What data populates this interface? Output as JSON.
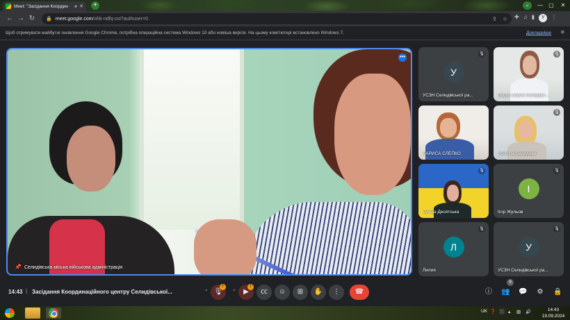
{
  "browser": {
    "tab_title": "Meet: \"Засідання Координ",
    "url_host": "meet.google.com",
    "url_path": "/ohk-ndfq-coi?authuser=0",
    "profile_initial": "У"
  },
  "infobar": {
    "message": "Щоб отримувати майбутні оновлення Google Chrome, потрібна операційна система Windows 10 або новіша версія. На цьому комп'ютері встановлено Windows 7.",
    "details_label": "Докладніше"
  },
  "main_video": {
    "name": "Селидівська міська військова адміністрація"
  },
  "participants": [
    {
      "name": "УСЗН Селидівської ра...",
      "initial": "У",
      "color": "#37474f"
    },
    {
      "name": "Відділ освіти Селидівс...",
      "initial": "",
      "color": ""
    },
    {
      "name": "ЛАРИСА СЛЕПКО",
      "initial": "",
      "color": ""
    },
    {
      "name": "УСЗН м.Селидове",
      "initial": "",
      "color": ""
    },
    {
      "name": "Олена Десятська",
      "initial": "",
      "color": ""
    },
    {
      "name": "Ігор Жульов",
      "initial": "І",
      "color": "#7cb342"
    },
    {
      "name": "Лилия",
      "initial": "Л",
      "color": "#00838f"
    },
    {
      "name": "УСЗН Селидівської ра...",
      "initial": "У",
      "color": "#37474f"
    }
  ],
  "meeting": {
    "time": "14:43",
    "separator": "|",
    "title": "Засідання Координаційного центру Селидівської...",
    "people_count": "9",
    "mic_badge": "!",
    "cam_badge": "!"
  },
  "taskbar": {
    "lang": "UK",
    "clock_time": "14:43",
    "clock_date": "19.09.2024"
  }
}
